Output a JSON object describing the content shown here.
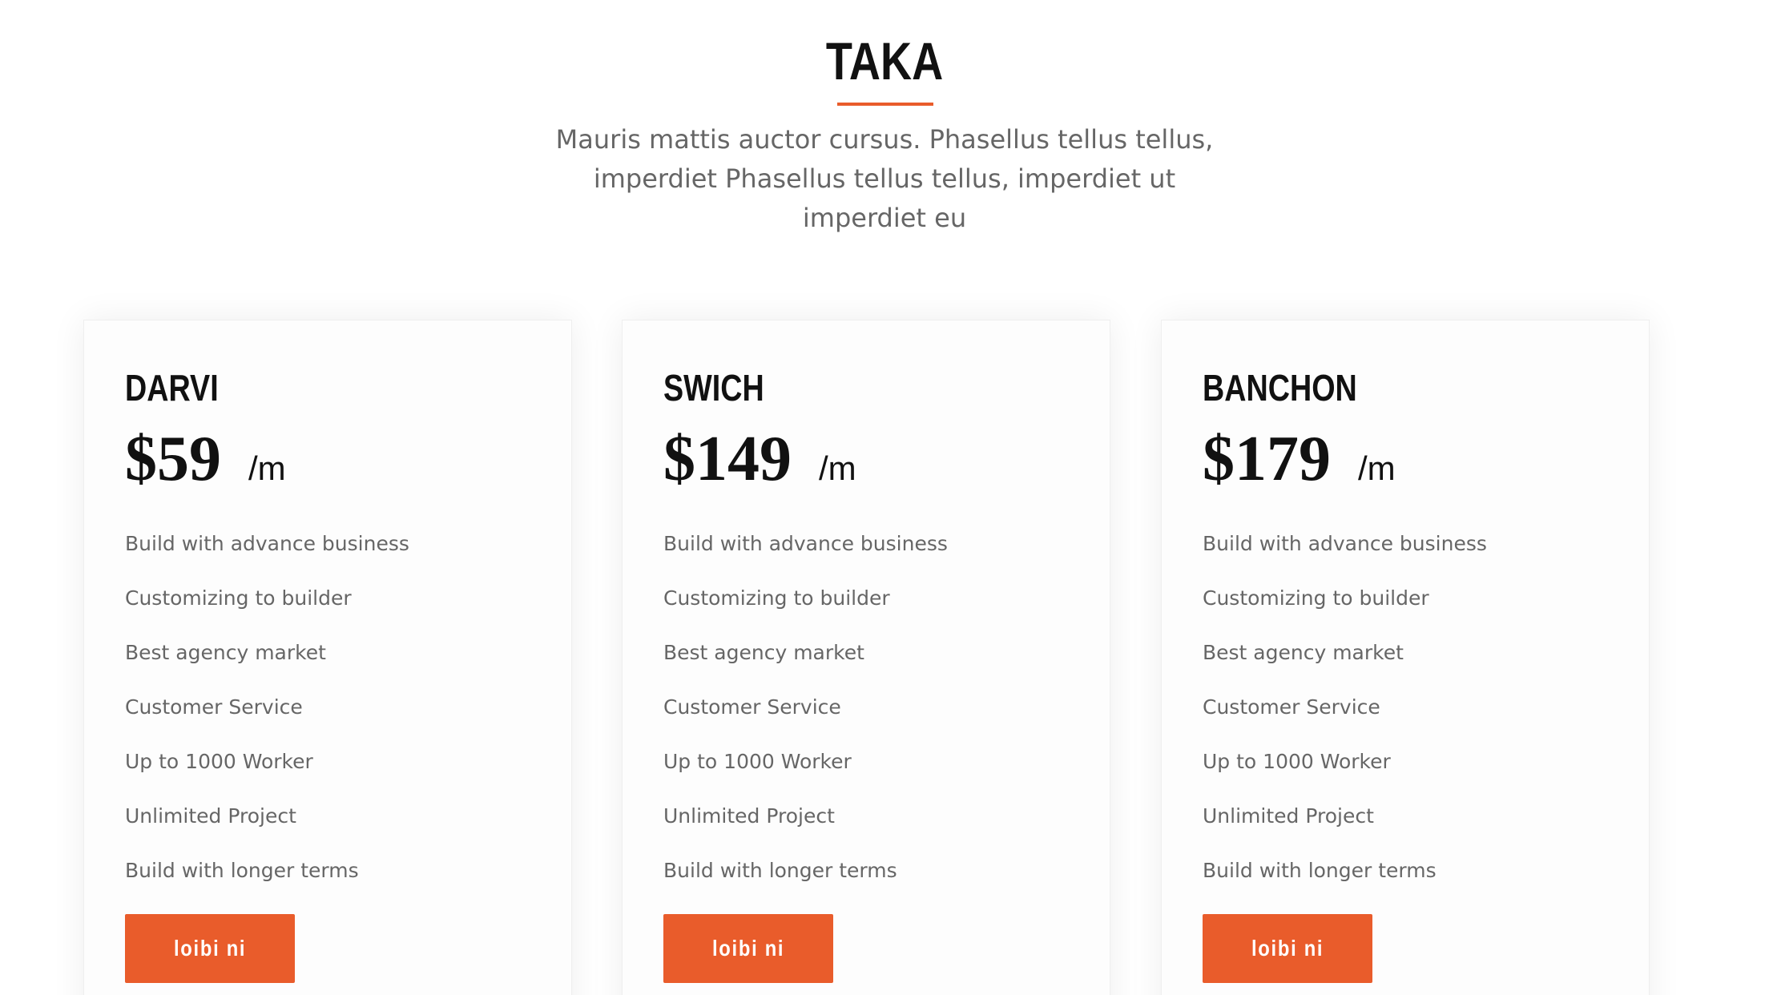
{
  "section": {
    "title": "TAKA",
    "subtitle_lines": [
      "Mauris mattis auctor cursus. Phasellus tellus tellus,",
      "imperdiet Phasellus tellus tellus, imperdiet ut",
      "imperdiet eu"
    ]
  },
  "colors": {
    "accent": "#e95c2b",
    "heading": "#111111",
    "body_text": "#666666",
    "card_bg": "#fdfdfd"
  },
  "plans": [
    {
      "name": "DARVI",
      "price": "$59",
      "period": "/m",
      "features": [
        "Build with advance business",
        "Customizing to builder",
        "Best agency market",
        "Customer Service",
        "Up to 1000 Worker",
        "Unlimited Project",
        "Build with longer terms"
      ],
      "button_label": "loibi ni"
    },
    {
      "name": "SWICH",
      "price": "$149",
      "period": "/m",
      "features": [
        "Build with advance business",
        "Customizing to builder",
        "Best agency market",
        "Customer Service",
        "Up to 1000 Worker",
        "Unlimited Project",
        "Build with longer terms"
      ],
      "button_label": "loibi ni"
    },
    {
      "name": "BANCHON",
      "price": "$179",
      "period": "/m",
      "features": [
        "Build with advance business",
        "Customizing to builder",
        "Best agency market",
        "Customer Service",
        "Up to 1000 Worker",
        "Unlimited Project",
        "Build with longer terms"
      ],
      "button_label": "loibi ni"
    }
  ]
}
